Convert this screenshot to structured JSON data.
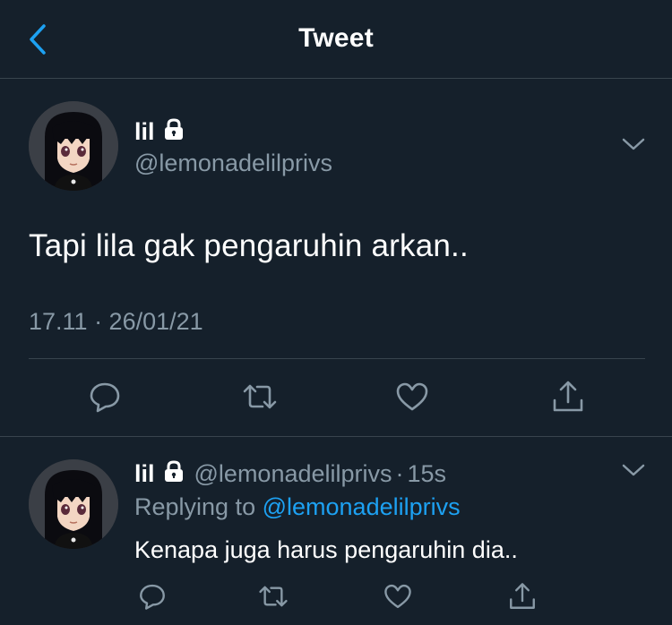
{
  "header": {
    "title": "Tweet",
    "back_icon": "chevron-left-icon"
  },
  "colors": {
    "background": "#15202b",
    "accent": "#1da1f2",
    "secondary_text": "#8899a6",
    "divider": "#38444d"
  },
  "main_tweet": {
    "display_name": "lil",
    "protected_icon": "lock-icon",
    "handle": "@lemonadelilprivs",
    "text": "Tapi lila gak pengaruhin arkan..",
    "timestamp": "17.11 · 26/01/21",
    "menu_icon": "chevron-down-icon",
    "actions": [
      "reply-icon",
      "retweet-icon",
      "like-icon",
      "share-icon"
    ]
  },
  "reply_tweet": {
    "display_name": "lil",
    "protected_icon": "lock-icon",
    "handle": "@lemonadelilprivs",
    "separator": "·",
    "time": "15s",
    "replying_to_label": "Replying to",
    "replying_to_handle": "@lemonadelilprivs",
    "text": "Kenapa juga harus pengaruhin dia..",
    "menu_icon": "chevron-down-icon",
    "actions": [
      "reply-icon",
      "retweet-icon",
      "like-icon",
      "share-icon"
    ]
  }
}
